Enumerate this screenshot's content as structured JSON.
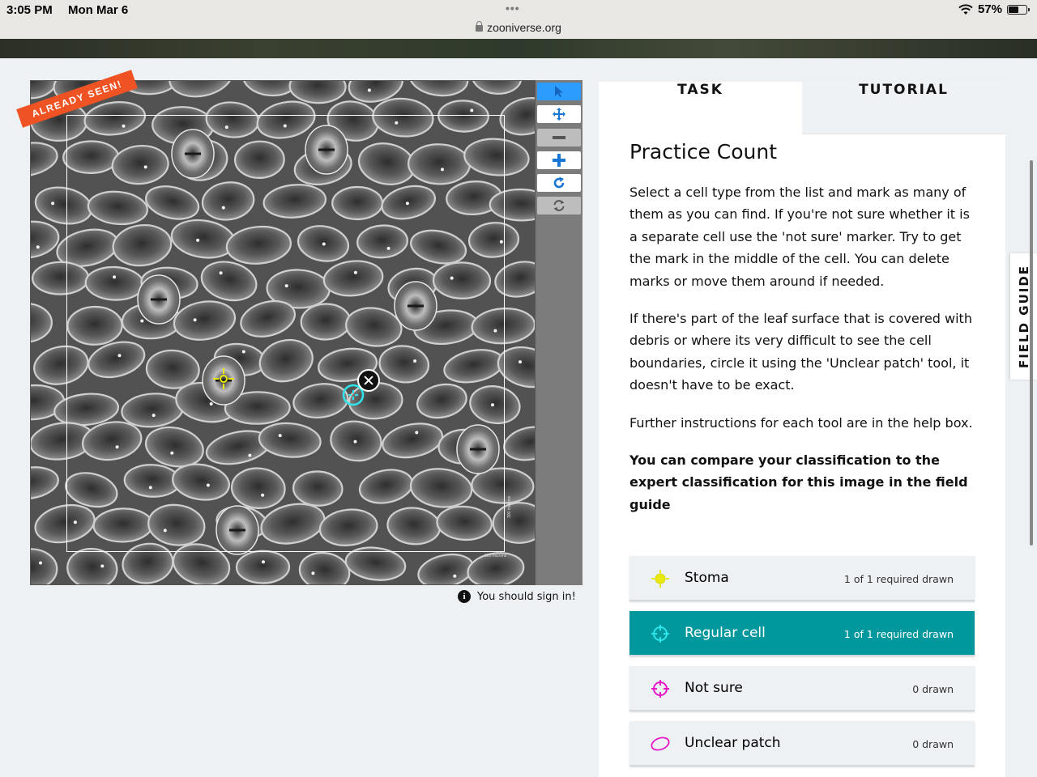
{
  "status_bar": {
    "time": "3:05 PM",
    "date": "Mon Mar 6",
    "url": "zooniverse.org",
    "battery": "57%",
    "battery_level": 0.57
  },
  "viewer": {
    "already_seen_label": "ALREADY SEEN!",
    "scale_label_h": "300 microns",
    "scale_label_v": "300 microns",
    "sign_in_message": "You should sign in!"
  },
  "toolbar": {
    "tools": [
      "pointer-icon",
      "pan-icon",
      "zoom-out-icon",
      "zoom-in-icon",
      "rotate-icon",
      "reset-icon"
    ],
    "accent": "#2d9cff"
  },
  "task_panel": {
    "tabs": [
      {
        "label": "TASK",
        "active": true
      },
      {
        "label": "TUTORIAL",
        "active": false
      }
    ],
    "title": "Practice Count",
    "paragraphs": [
      "Select a cell type from the list and mark as many of them as you can find. If you're not sure whether it is a separate cell use the 'not sure' marker. Try to get the mark in the middle of the cell. You can delete marks or move them around if needed.",
      "If there's part of the leaf surface that is covered with debris or where its very difficult to see the cell boundaries, circle it using the 'Unclear patch' tool, it doesn't have to be exact.",
      "Further instructions for each tool are in the help box."
    ],
    "bold_paragraph": "You can compare your classification to the expert classification for this image in the field guide",
    "tools": [
      {
        "label": "Stoma",
        "count": "1 of 1 required drawn",
        "color": "#e8e80a",
        "icon": "stoma-marker-icon",
        "selected": false
      },
      {
        "label": "Regular cell",
        "count": "1 of 1 required drawn",
        "color": "#2ee6ea",
        "icon": "crosshair-icon",
        "selected": true
      },
      {
        "label": "Not sure",
        "count": "0 drawn",
        "color": "#e619c8",
        "icon": "crosshair-icon",
        "selected": false
      },
      {
        "label": "Unclear patch",
        "count": "0 drawn",
        "color": "#e619c8",
        "icon": "ellipse-icon",
        "selected": false
      }
    ],
    "selected_color": "#00979d"
  },
  "field_guide": {
    "label": "FIELD GUIDE"
  }
}
